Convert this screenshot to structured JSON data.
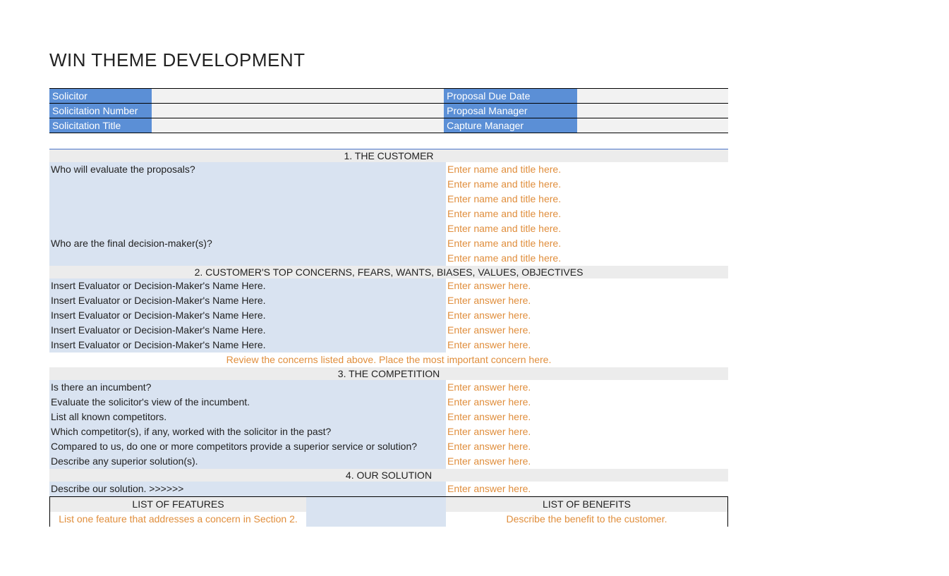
{
  "title": "WIN THEME DEVELOPMENT",
  "meta": {
    "solicitor_label": "Solicitor",
    "solicitor_value": "",
    "solicitation_number_label": "Solicitation Number",
    "solicitation_number_value": "",
    "solicitation_title_label": "Solicitation Title",
    "solicitation_title_value": "",
    "proposal_due_label": "Proposal Due Date",
    "proposal_due_value": "",
    "proposal_manager_label": "Proposal Manager",
    "proposal_manager_value": "",
    "capture_manager_label": "Capture Manager",
    "capture_manager_value": ""
  },
  "sections": {
    "s1_header": "1. THE CUSTOMER",
    "s1_q1": "Who will evaluate the proposals?",
    "s1_a_placeholder": "Enter name and title here.",
    "s1_q2": "Who are the final decision-maker(s)?",
    "s2_header": "2. CUSTOMER'S TOP CONCERNS, FEARS, WANTS, BIASES, VALUES, OBJECTIVES",
    "s2_name_placeholder": "Insert Evaluator or Decision-Maker's Name Here.",
    "s2_answer_placeholder": "Enter answer here.",
    "s2_review": "Review the concerns listed above. Place the most important concern here.",
    "s3_header": "3. THE COMPETITION",
    "s3_rows": [
      "Is there an incumbent?",
      "Evaluate the solicitor's view of the incumbent.",
      "List all known competitors.",
      "Which competitor(s), if any, worked with the solicitor in the past?",
      "Compared to us, do one or more competitors provide a superior service or solution?",
      "Describe any superior solution(s)."
    ],
    "s4_header": "4. OUR SOLUTION",
    "s4_describe": "Describe our solution. >>>>>>",
    "s4_features_header": "LIST OF FEATURES",
    "s4_benefits_header": "LIST OF BENEFITS",
    "s4_feature_placeholder": "List one feature that addresses a concern in Section 2.",
    "s4_benefit_placeholder": "Describe the benefit to the customer."
  }
}
